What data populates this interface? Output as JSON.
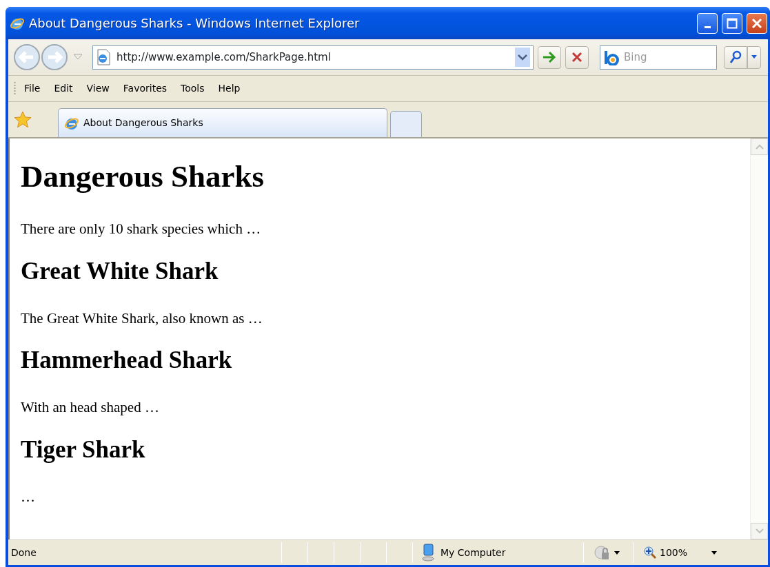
{
  "window": {
    "title": "About Dangerous Sharks - Windows Internet Explorer"
  },
  "address": {
    "url": "http://www.example.com/SharkPage.html"
  },
  "search": {
    "placeholder": "Bing"
  },
  "menu": [
    "File",
    "Edit",
    "View",
    "Favorites",
    "Tools",
    "Help"
  ],
  "tabs": [
    {
      "label": "About Dangerous Sharks",
      "selected": true
    }
  ],
  "content": [
    {
      "kind": "h1",
      "text": "Dangerous Sharks"
    },
    {
      "kind": "p",
      "text": "There are only 10 shark species which …"
    },
    {
      "kind": "h2",
      "text": "Great White Shark"
    },
    {
      "kind": "p",
      "text": "The Great White Shark, also known as …"
    },
    {
      "kind": "h2",
      "text": "Hammerhead Shark"
    },
    {
      "kind": "p",
      "text": "With an head shaped …"
    },
    {
      "kind": "h2",
      "text": "Tiger Shark"
    },
    {
      "kind": "p",
      "text": "…"
    }
  ],
  "status_bar": {
    "text": "Done",
    "zone": "My Computer",
    "zoom": "100%"
  }
}
